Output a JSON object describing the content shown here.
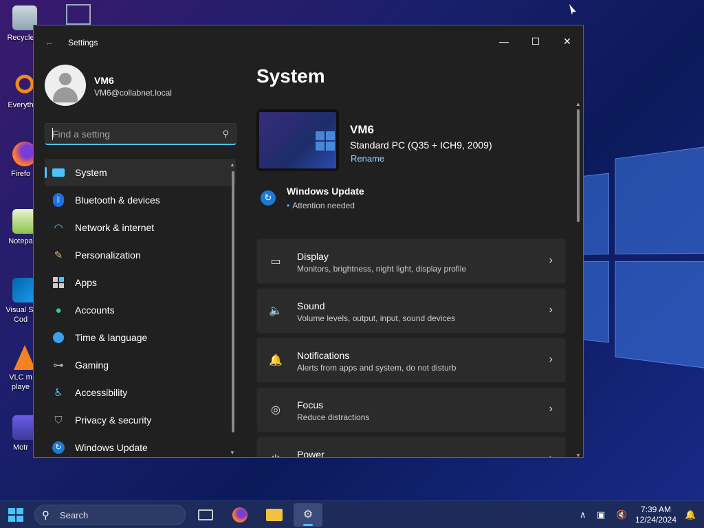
{
  "desktop": {
    "icons": [
      {
        "label": "Recycle",
        "icon": "recycle-bin-icon"
      },
      {
        "label": "Everyth",
        "icon": "everything-search-icon"
      },
      {
        "label": "Firefo",
        "icon": "firefox-icon"
      },
      {
        "label": "Notepa",
        "icon": "notepad-icon"
      },
      {
        "label": "Visual St\nCod",
        "icon": "vscode-icon"
      },
      {
        "label": "VLC m\nplaye",
        "icon": "vlc-icon"
      },
      {
        "label": "Motr",
        "icon": "motrix-icon"
      }
    ]
  },
  "window": {
    "title": "Settings",
    "controls": {
      "minimize": "—",
      "maximize": "☐",
      "close": "✕"
    }
  },
  "profile": {
    "name": "VM6",
    "email": "VM6@collabnet.local"
  },
  "search": {
    "placeholder": "Find a setting"
  },
  "nav": {
    "items": [
      {
        "label": "System",
        "icon": "system-icon",
        "active": true
      },
      {
        "label": "Bluetooth & devices",
        "icon": "bluetooth-icon"
      },
      {
        "label": "Network & internet",
        "icon": "wifi-icon"
      },
      {
        "label": "Personalization",
        "icon": "brush-icon"
      },
      {
        "label": "Apps",
        "icon": "apps-icon"
      },
      {
        "label": "Accounts",
        "icon": "accounts-icon"
      },
      {
        "label": "Time & language",
        "icon": "globe-clock-icon"
      },
      {
        "label": "Gaming",
        "icon": "gamepad-icon"
      },
      {
        "label": "Accessibility",
        "icon": "accessibility-icon"
      },
      {
        "label": "Privacy & security",
        "icon": "shield-icon"
      },
      {
        "label": "Windows Update",
        "icon": "update-icon"
      }
    ]
  },
  "main": {
    "title": "System",
    "device": {
      "name": "VM6",
      "spec": "Standard PC (Q35 + ICH9, 2009)",
      "rename": "Rename"
    },
    "windows_update": {
      "title": "Windows Update",
      "status": "Attention needed"
    },
    "cards": [
      {
        "title": "Display",
        "subtitle": "Monitors, brightness, night light, display profile",
        "icon": "display-icon"
      },
      {
        "title": "Sound",
        "subtitle": "Volume levels, output, input, sound devices",
        "icon": "speaker-icon"
      },
      {
        "title": "Notifications",
        "subtitle": "Alerts from apps and system, do not disturb",
        "icon": "bell-icon"
      },
      {
        "title": "Focus",
        "subtitle": "Reduce distractions",
        "icon": "focus-icon"
      },
      {
        "title": "Power",
        "subtitle": "",
        "icon": "power-icon"
      }
    ]
  },
  "taskbar": {
    "search_label": "Search",
    "apps": [
      {
        "name": "task-view",
        "icon": "task-view-icon"
      },
      {
        "name": "firefox",
        "icon": "firefox-icon"
      },
      {
        "name": "file-explorer",
        "icon": "folder-icon"
      },
      {
        "name": "settings",
        "icon": "gear-icon",
        "active": true
      }
    ],
    "clock": {
      "time": "7:39 AM",
      "date": "12/24/2024"
    }
  },
  "colors": {
    "accent": "#4cc2ff",
    "window_bg": "#202020",
    "card_bg": "#2b2b2b"
  }
}
